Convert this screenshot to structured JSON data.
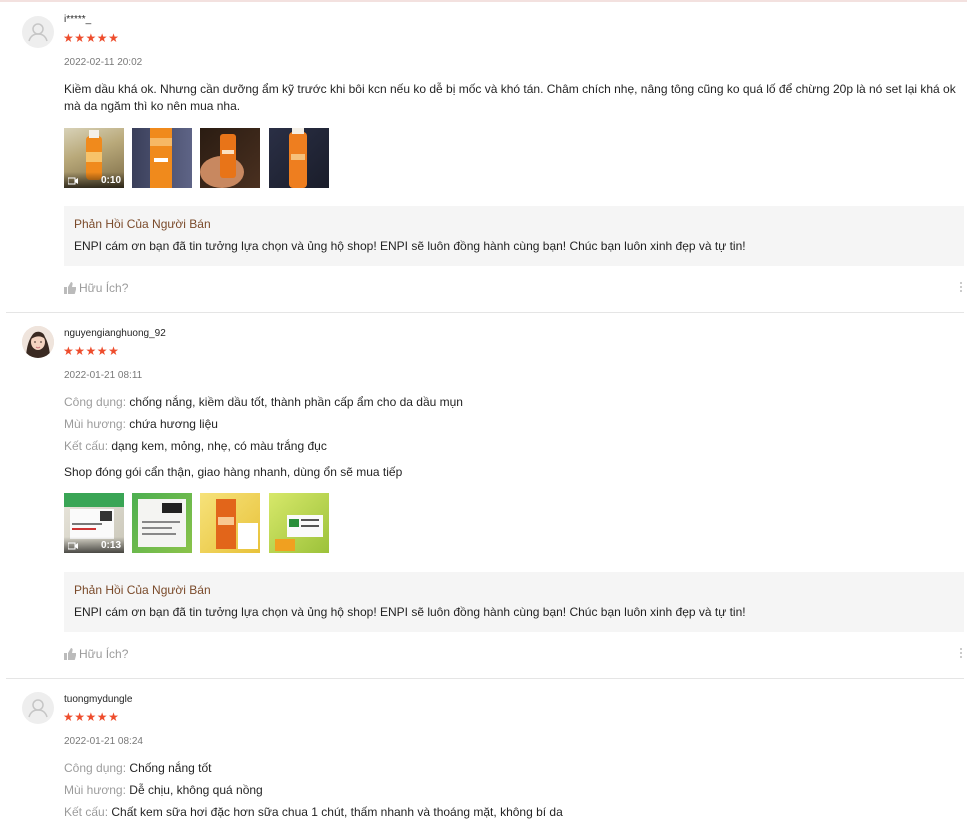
{
  "colors": {
    "star": "#ee4d2d",
    "reply_title": "#7a4a2a",
    "reply_bg": "#f5f5f5"
  },
  "reviews": [
    {
      "username": "i*****_",
      "stars": [
        "★",
        "★",
        "★",
        "★",
        "★"
      ],
      "date": "2022-02-11 20:02",
      "content": "Kiềm dầu khá ok. Nhưng cần dưỡng ẩm kỹ trước khi bôi kcn nếu ko dễ bị mốc và khó tán. Châm chích nhẹ, nâng tông cũng ko quá lố để chừng 20p là nó set lại khá ok mà da ngăm thì ko nên mua nha.",
      "video_duration": "0:10",
      "seller_reply": {
        "title": "Phản Hồi Của Người Bán",
        "text": "ENPI cám ơn bạn đã tin tưởng lựa chọn và ủng hộ shop! ENPI sẽ luôn đồng hành cùng bạn! Chúc bạn luôn xinh đẹp và tự tin!"
      },
      "helpful": "Hữu Ích?"
    },
    {
      "username": "nguyengianghuong_92",
      "stars": [
        "★",
        "★",
        "★",
        "★",
        "★"
      ],
      "date": "2022-01-21 08:11",
      "attributes": [
        {
          "label": "Công dụng:",
          "value": "chống nắng, kiềm dầu tốt, thành phần cấp ẩm cho da dầu mụn"
        },
        {
          "label": "Mùi hương:",
          "value": "chứa hương liệu"
        },
        {
          "label": "Kết cấu:",
          "value": "dạng kem, mỏng, nhẹ, có màu trắng đục"
        }
      ],
      "content": "Shop đóng gói cẩn thận, giao hàng nhanh, dùng ổn sẽ mua tiếp",
      "video_duration": "0:13",
      "seller_reply": {
        "title": "Phản Hồi Của Người Bán",
        "text": "ENPI cám ơn bạn đã tin tưởng lựa chọn và ủng hộ shop! ENPI sẽ luôn đồng hành cùng bạn! Chúc bạn luôn xinh đẹp và tự tin!"
      },
      "helpful": "Hữu Ích?"
    },
    {
      "username": "tuongmydungle",
      "stars": [
        "★",
        "★",
        "★",
        "★",
        "★"
      ],
      "date": "2022-01-21 08:24",
      "attributes": [
        {
          "label": "Công dụng:",
          "value": "Chống nắng tốt"
        },
        {
          "label": "Mùi hương:",
          "value": "Dễ chịu, không quá nồng"
        },
        {
          "label": "Kết cấu:",
          "value": "Chất kem sữa hơi đặc hơn sữa chua 1 chút, thấm nhanh và thoáng mặt, không bí da"
        }
      ]
    }
  ]
}
